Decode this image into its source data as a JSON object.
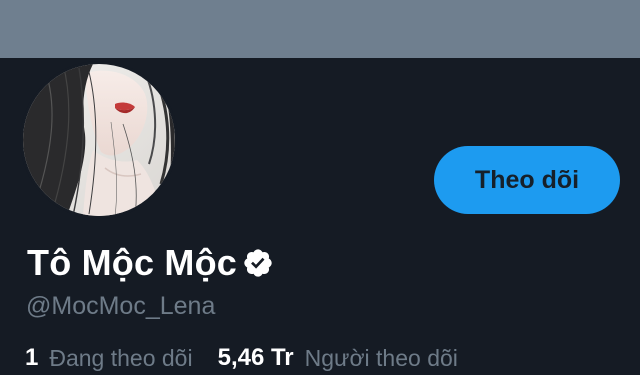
{
  "profile": {
    "display_name": "Tô Mộc Mộc",
    "handle": "@MocMoc_Lena",
    "verified": true
  },
  "follow_button": {
    "label": "Theo dõi"
  },
  "stats": {
    "following_count": "1",
    "following_label": "Đang theo dõi",
    "followers_count": "5,46 Tr",
    "followers_label": "Người theo dõi"
  },
  "colors": {
    "banner": "#6f7f8f",
    "background": "#151b24",
    "accent": "#1d9bf0",
    "secondary_text": "#6e7b88"
  },
  "icons": {
    "verified": "verified-badge-icon"
  }
}
